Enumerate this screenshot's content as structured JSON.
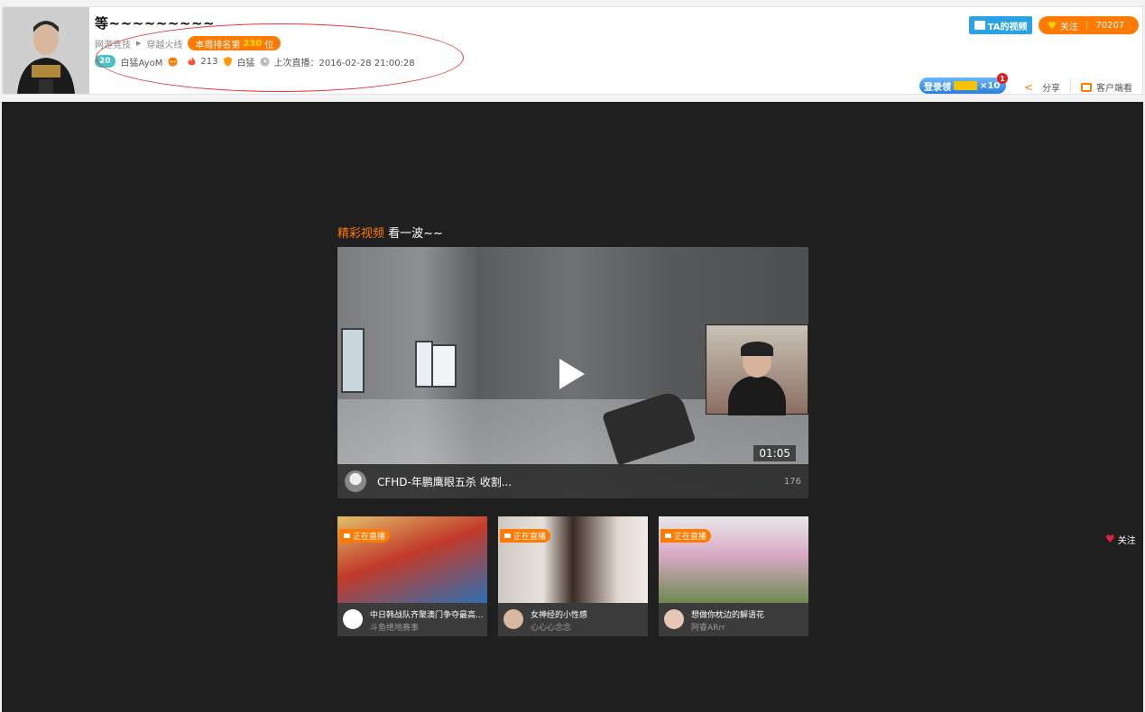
{
  "streamer": {
    "title": "等~~~~~~~~~",
    "category_parent": "网游竞技",
    "category": "穿越火线",
    "rank_prefix": "本周排名第",
    "rank_value": "230",
    "rank_suffix": "位",
    "level": "20",
    "name": "白猛AyoM",
    "heat": "213",
    "guild": "白猛",
    "last_live": "上次直播：2016-02-28 21:00:28"
  },
  "header_actions": {
    "video_label": "TA的视频",
    "follow_label": "关注",
    "follow_count": "70207",
    "login_label": "登录领",
    "login_reward": "×10",
    "login_badge": "1",
    "share_label": "分享",
    "client_label": "客户端看"
  },
  "section": {
    "title_highlight": "精彩视频",
    "title_rest": "看一波~~"
  },
  "main_video": {
    "duration": "01:05",
    "title": "CFHD-年鹏鹰眼五杀 收割...",
    "count": "176"
  },
  "thumbs": [
    {
      "live_label": "正在直播",
      "title": "中日韩战队齐聚澳门争夺最高...",
      "user": "斗鱼绝地赛事",
      "colors": [
        "#c23a2a",
        "#2d6fb0"
      ]
    },
    {
      "live_label": "正在直播",
      "title": "女神经的小性感",
      "user": "心心心念念",
      "colors": [
        "#d9d2cc",
        "#3a2a22"
      ]
    },
    {
      "live_label": "正在直播",
      "title": "想做你枕边的解语花",
      "user": "阿睿ARrr",
      "colors": [
        "#d8a9c4",
        "#6c8a4e"
      ]
    }
  ],
  "side_follow_label": "关注"
}
